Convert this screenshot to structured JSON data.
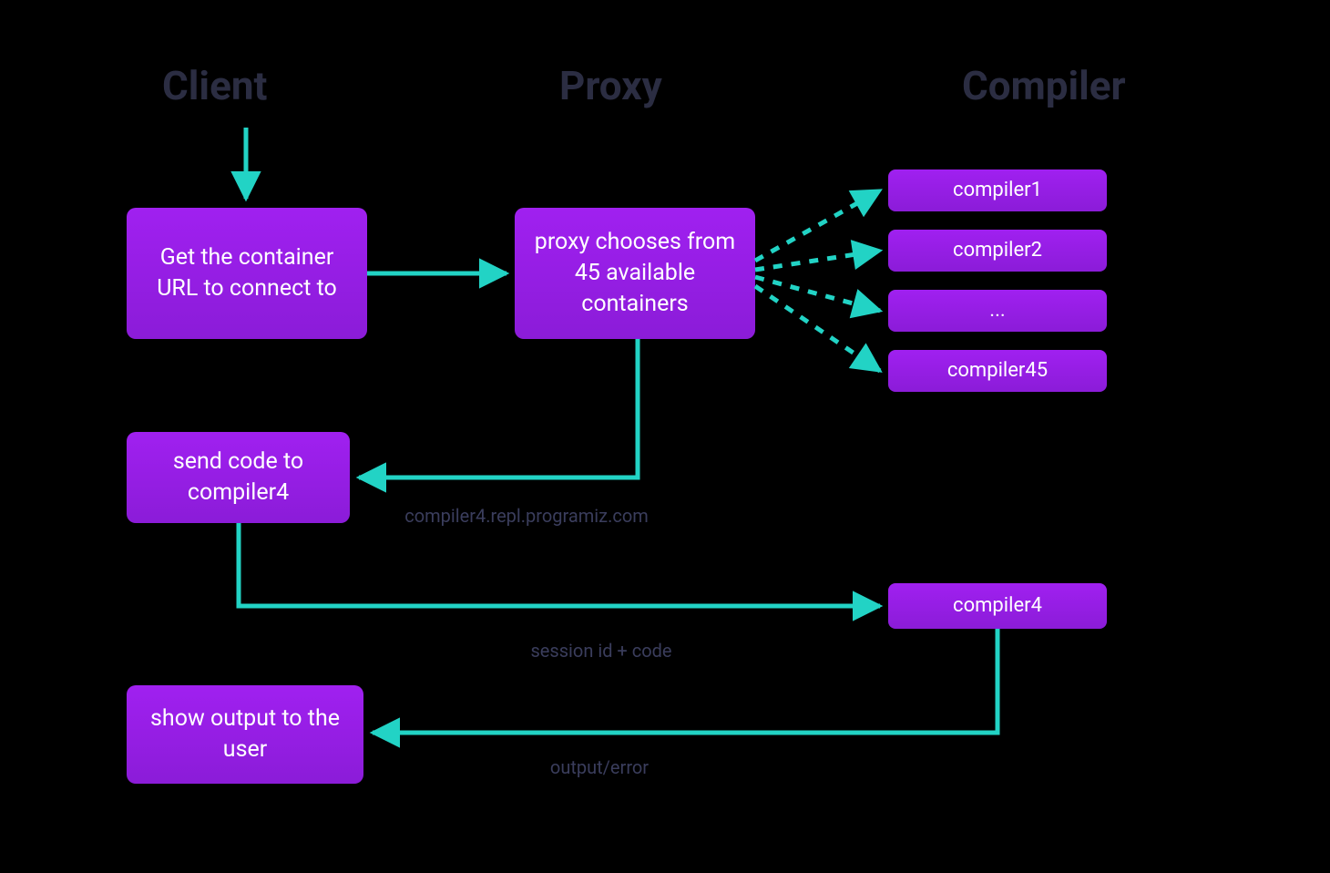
{
  "headings": {
    "client": "Client",
    "proxy": "Proxy",
    "compiler": "Compiler"
  },
  "nodes": {
    "client_get_url": "Get the container URL to connect to",
    "proxy_choose": "proxy chooses from 45 available containers",
    "compiler1": "compiler1",
    "compiler2": "compiler2",
    "compiler_dots": "...",
    "compiler45": "compiler45",
    "client_send": "send code to compiler4",
    "compiler4": "compiler4",
    "client_show": "show output to the user"
  },
  "edge_labels": {
    "url": "compiler4.repl.programiz.com",
    "session": "session id + code",
    "output": "output/error"
  },
  "colors": {
    "arrow": "#22d3c5",
    "node_bg": "#a020f0",
    "heading": "#2b2d42",
    "edge_label": "#3a3d5c"
  }
}
